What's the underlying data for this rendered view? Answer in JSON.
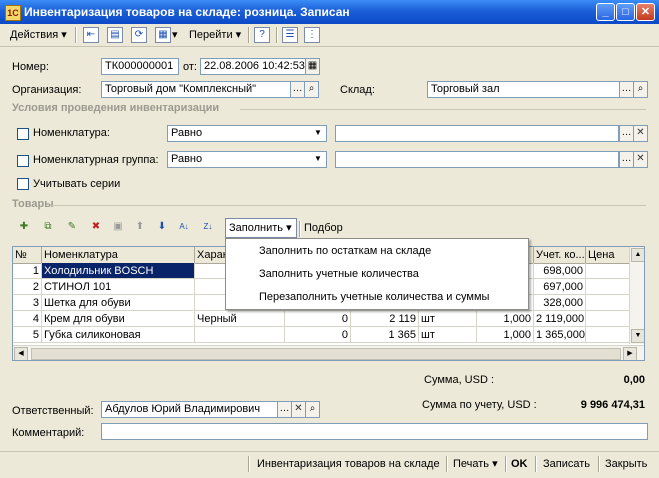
{
  "window": {
    "title": "Инвентаризация товаров на складе: розница. Записан",
    "minimize": "_",
    "maximize": "□",
    "close": "✕"
  },
  "toolbar": {
    "actions": "Действия",
    "goto": "Перейти",
    "help": "?"
  },
  "form": {
    "number_label": "Номер:",
    "number": "ТК000000001",
    "date_label": "от:",
    "date": "22.08.2006 10:42:53",
    "org_label": "Организация:",
    "org": "Торговый дом \"Комплексный\"",
    "warehouse_label": "Склад:",
    "warehouse": "Торговый зал"
  },
  "conditions": {
    "title": "Условия проведения инвентаризации",
    "nomenclature_label": "Номенклатура:",
    "nomenclature_cmp": "Равно",
    "group_label": "Номенклатурная группа:",
    "group_cmp": "Равно",
    "series_label": "Учитывать серии"
  },
  "goods": {
    "title": "Товары",
    "fill_button": "Заполнить",
    "pick_button": "Подбор",
    "headers": [
      "№",
      "Номенклатура",
      "Харак",
      "",
      "",
      "",
      "",
      "Учет. ко...",
      "Цена"
    ],
    "rows": [
      {
        "n": "1",
        "name": "Холодильник BOSCH",
        "char": "",
        "a": "",
        "b": "",
        "unit": "",
        "k": "",
        "acc": "698,000"
      },
      {
        "n": "2",
        "name": "СТИНОЛ 101",
        "char": "",
        "a": "",
        "b": "",
        "unit": "",
        "k": "",
        "acc": "697,000"
      },
      {
        "n": "3",
        "name": "Шетка для обуви",
        "char": "",
        "a": "",
        "b": "",
        "unit": "",
        "k": "",
        "acc": "328,000"
      },
      {
        "n": "4",
        "name": "Крем для обуви",
        "char": "Черный",
        "a": "0",
        "b": "2 119",
        "unit": "шт",
        "k": "1,000",
        "acc": "2 119,000"
      },
      {
        "n": "5",
        "name": "Губка силиконовая",
        "char": "",
        "a": "0",
        "b": "1 365",
        "unit": "шт",
        "k": "1,000",
        "acc": "1 365,000"
      }
    ]
  },
  "fill_menu": {
    "items": [
      "Заполнить по остаткам на складе",
      "Заполнить учетные количества",
      "Перезаполнить учетные количества и суммы"
    ]
  },
  "totals": {
    "sum_label": "Сумма, USD :",
    "sum": "0,00",
    "acc_sum_label": "Сумма по учету, USD :",
    "acc_sum": "9 996 474,31"
  },
  "responsible": {
    "label": "Ответственный:",
    "value": "Абдулов Юрий Владимирович"
  },
  "comment": {
    "label": "Комментарий:",
    "value": ""
  },
  "bottom": {
    "report": "Инвентаризация товаров на складе",
    "print": "Печать",
    "ok": "OK",
    "save": "Записать",
    "close": "Закрыть"
  }
}
